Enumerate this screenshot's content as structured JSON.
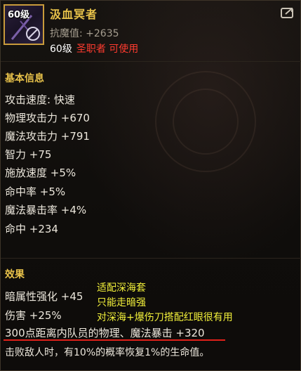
{
  "item": {
    "level_badge": "60级",
    "name": "汲血冥者",
    "resist": "抗魔值: +2635",
    "requirement_level": "60级",
    "requirement_class": "圣职者 可使用"
  },
  "basic_info": {
    "title": "基本信息",
    "stats": [
      "攻击速度: 快速",
      "物理攻击力 +670",
      "魔法攻击力 +791",
      "智力 +75",
      "施放速度 +5%",
      "命中率 +5%",
      "魔法暴击率 +4%",
      "命中 +234"
    ]
  },
  "effects": {
    "title": "效果",
    "lines": [
      "暗属性强化 +45",
      "伤害 +25%",
      "300点距离内队员的物理、魔法暴击 +320"
    ],
    "description": "击败敌人时，有10%的概率恢复1%的生命值。"
  },
  "annotations": [
    "适配深海套",
    "只能走暗强",
    "对深海+爆伤刀搭配红眼很有用"
  ],
  "colors": {
    "title": "#e8c24a",
    "class_requirement": "#ff3b2f",
    "annotation": "#f2f03a",
    "underline": "#e0201a"
  },
  "icons": {
    "item": "cross-staff-icon",
    "corner": "share-icon"
  }
}
